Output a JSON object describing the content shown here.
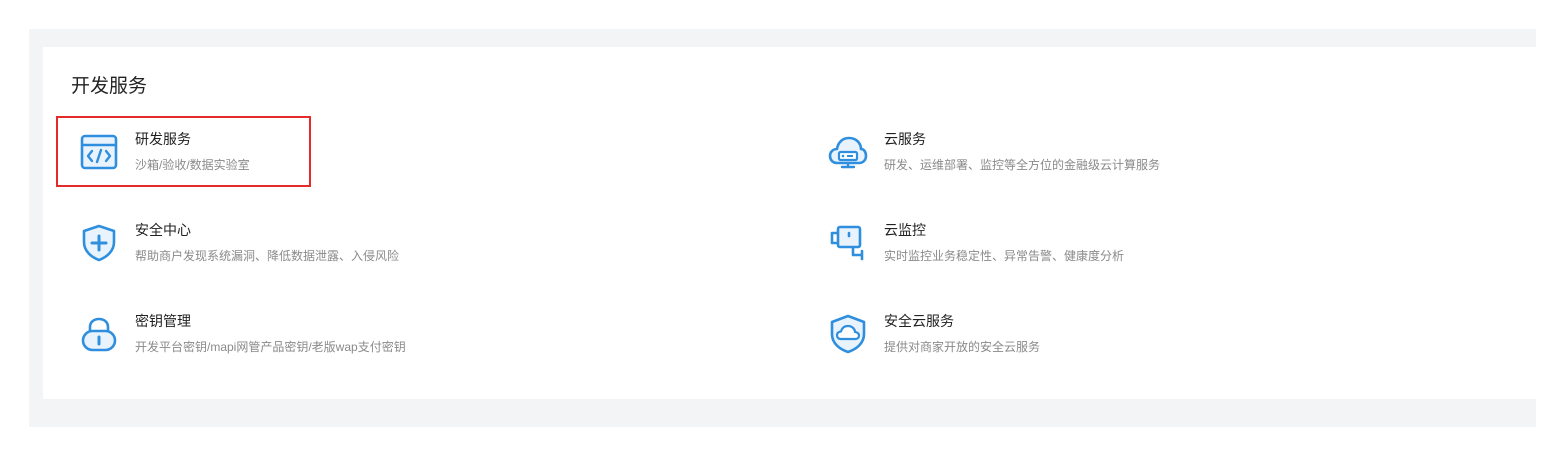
{
  "section": {
    "title": "开发服务"
  },
  "services_left": [
    {
      "name": "研发服务",
      "desc": "沙箱/验收/数据实验室",
      "icon": "code-window-icon"
    },
    {
      "name": "安全中心",
      "desc": "帮助商户发现系统漏洞、降低数据泄露、入侵风险",
      "icon": "shield-plus-icon"
    },
    {
      "name": "密钥管理",
      "desc": "开发平台密钥/mapi网管产品密钥/老版wap支付密钥",
      "icon": "lock-icon"
    }
  ],
  "services_right": [
    {
      "name": "云服务",
      "desc": "研发、运维部署、监控等全方位的金融级云计算服务",
      "icon": "cloud-server-icon"
    },
    {
      "name": "云监控",
      "desc": "实时监控业务稳定性、异常告警、健康度分析",
      "icon": "camera-monitor-icon"
    },
    {
      "name": "安全云服务",
      "desc": "提供对商家开放的安全云服务",
      "icon": "shield-cloud-icon"
    }
  ],
  "colors": {
    "accent": "#2f8fde",
    "highlight_border": "#e52a2a",
    "title_text": "#222222",
    "desc_text": "#8a8a8a"
  }
}
